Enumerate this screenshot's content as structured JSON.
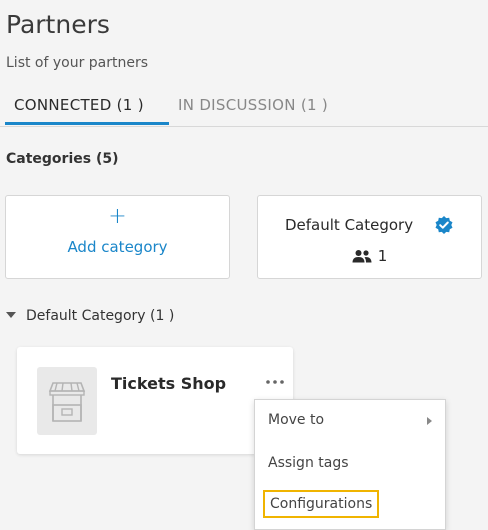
{
  "header": {
    "title": "Partners",
    "subtitle": "List of your partners"
  },
  "tabs": [
    {
      "label": "CONNECTED (1 )",
      "active": true
    },
    {
      "label": "IN DISCUSSION (1 )",
      "active": false
    }
  ],
  "categories": {
    "label": "Categories (5)",
    "add_label": "Add category",
    "default_card": {
      "title": "Default Category",
      "count": "1"
    }
  },
  "group": {
    "header": "Default Category (1 )"
  },
  "partner": {
    "name": "Tickets Shop"
  },
  "menu": {
    "items": [
      "Move to",
      "Assign tags",
      "Configurations"
    ]
  },
  "colors": {
    "accent": "#1a86c9",
    "highlight": "#f0b400",
    "background": "#f4f4f4"
  }
}
